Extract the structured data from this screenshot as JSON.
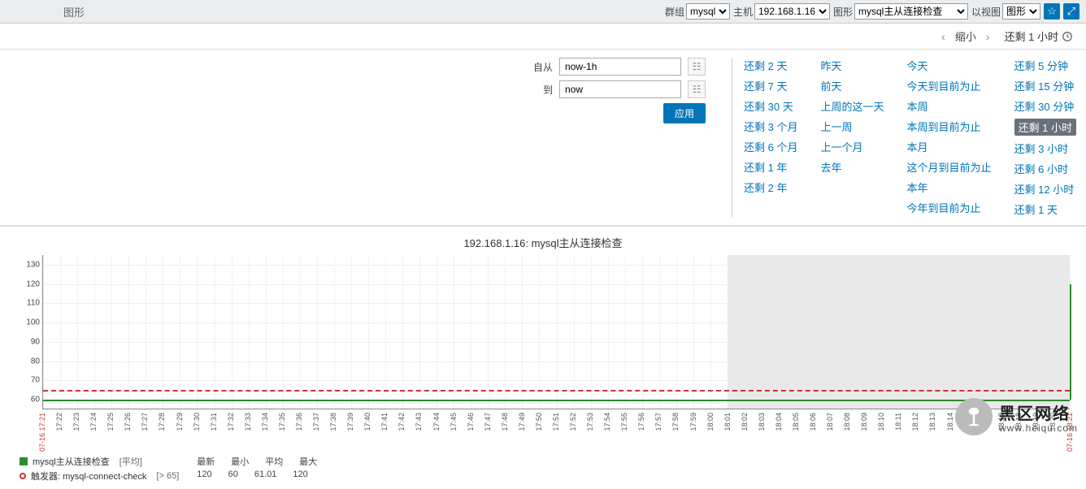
{
  "top": {
    "title": "图形",
    "filters": {
      "group_label": "群组",
      "group_value": "mysql",
      "host_label": "主机",
      "host_value": "192.168.1.16",
      "graph_label": "图形",
      "graph_value": "mysql主从连接检查",
      "view_label": "以视图",
      "view_value": "图形"
    },
    "star_icon": "star-icon",
    "fullscreen_icon": "fullscreen-icon"
  },
  "zoom": {
    "prev": "‹",
    "label": "缩小",
    "next": "›",
    "status": "还剩 1 小时"
  },
  "time_inputs": {
    "from_label": "自从",
    "from_value": "now-1h",
    "to_label": "到",
    "to_value": "now",
    "apply": "应用"
  },
  "quick_ranges": {
    "col1": [
      "还剩 2 天",
      "还剩 7 天",
      "还剩 30 天",
      "还剩 3 个月",
      "还剩 6 个月",
      "还剩 1 年",
      "还剩 2 年"
    ],
    "col2": [
      "昨天",
      "前天",
      "上周的这一天",
      "上一周",
      "上一个月",
      "去年"
    ],
    "col3": [
      "今天",
      "今天到目前为止",
      "本周",
      "本周到目前为止",
      "本月",
      "这个月到目前为止",
      "本年",
      "今年到目前为止"
    ],
    "col4": [
      "还剩 5 分钟",
      "还剩 15 分钟",
      "还剩 30 分钟",
      "还剩 1 小时",
      "还剩 3 小时",
      "还剩 6 小时",
      "还剩 12 小时",
      "还剩 1 天"
    ],
    "selected": "还剩 1 小时"
  },
  "chart": {
    "title": "192.168.1.16: mysql主从连接检查"
  },
  "chart_data": {
    "type": "line",
    "title": "192.168.1.16: mysql主从连接检查",
    "ylabel": "",
    "ylim": [
      55,
      135
    ],
    "y_ticks": [
      60,
      70,
      80,
      90,
      100,
      110,
      120,
      130
    ],
    "x_ticks": [
      "07-16 17:21",
      "17:22",
      "17:23",
      "17:24",
      "17:25",
      "17:26",
      "17:27",
      "17:28",
      "17:29",
      "17:30",
      "17:31",
      "17:32",
      "17:33",
      "17:34",
      "17:35",
      "17:36",
      "17:37",
      "17:38",
      "17:39",
      "17:40",
      "17:41",
      "17:42",
      "17:43",
      "17:44",
      "17:45",
      "17:46",
      "17:47",
      "17:48",
      "17:49",
      "17:50",
      "17:51",
      "17:52",
      "17:53",
      "17:54",
      "17:55",
      "17:56",
      "17:57",
      "17:58",
      "17:59",
      "18:00",
      "18:01",
      "18:02",
      "18:03",
      "18:04",
      "18:05",
      "18:06",
      "18:07",
      "18:08",
      "18:09",
      "18:10",
      "18:11",
      "18:12",
      "18:13",
      "18:14",
      "18:15",
      "18:16",
      "18:17",
      "18:18",
      "18:19",
      "18:20",
      "07-16 18:21"
    ],
    "series": [
      {
        "name": "mysql主从连接检查",
        "color": "#2e8b2e",
        "latest": 120,
        "min": 60,
        "avg": 61.01,
        "max": 120
      }
    ],
    "thresholds": [
      {
        "name": "触发器: mysql-connect-check",
        "value": 65,
        "condition": "[> 65]",
        "color": "#cc3333"
      }
    ],
    "shaded_future_from_index": 40,
    "jump": {
      "from_value": 60,
      "to_value": 120,
      "at_index": 60
    }
  },
  "legend": {
    "headers": [
      "最新",
      "最小",
      "平均",
      "最大"
    ],
    "row1_name": "mysql主从连接检查",
    "row1_kind": "[平均]",
    "row1_vals": [
      "120",
      "60",
      "61.01",
      "120"
    ],
    "row2_name": "触发器: mysql-connect-check",
    "row2_cond": "[> 65]"
  },
  "watermark": {
    "big": "黑区网络",
    "small": "www.heiqu.com"
  }
}
